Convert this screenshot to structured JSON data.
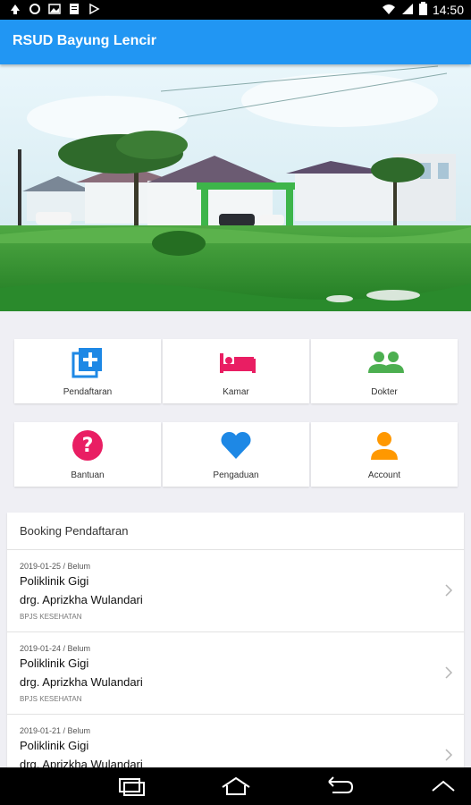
{
  "status_bar": {
    "time": "14:50",
    "left_icons": [
      "notification-icon",
      "sync-icon",
      "image-icon",
      "document-icon",
      "play-icon"
    ],
    "right_icons": [
      "wifi-icon",
      "signal-icon",
      "battery-icon"
    ]
  },
  "app_bar": {
    "title": "RSUD Bayung Lencir"
  },
  "hero": {
    "image": "hospital-building-photo"
  },
  "menu": [
    {
      "label": "Pendaftaran",
      "icon": "add-box-icon",
      "color": "#1e88e5"
    },
    {
      "label": "Kamar",
      "icon": "bed-icon",
      "color": "#e91e63"
    },
    {
      "label": "Dokter",
      "icon": "people-icon",
      "color": "#4caf50"
    },
    {
      "label": "Bantuan",
      "icon": "help-icon",
      "color": "#e91e63"
    },
    {
      "label": "Pengaduan",
      "icon": "heart-icon",
      "color": "#1e88e5"
    },
    {
      "label": "Account",
      "icon": "person-icon",
      "color": "#ff9800"
    }
  ],
  "booking": {
    "title": "Booking Pendaftaran",
    "items": [
      {
        "date_status": "2019-01-25 / Belum",
        "poli": "Poliklinik Gigi",
        "doctor": "drg. Aprizkha Wulandari",
        "insurance": "BPJS KESEHATAN"
      },
      {
        "date_status": "2019-01-24 / Belum",
        "poli": "Poliklinik Gigi",
        "doctor": "drg. Aprizkha Wulandari",
        "insurance": "BPJS KESEHATAN"
      },
      {
        "date_status": "2019-01-21 / Belum",
        "poli": "Poliklinik Gigi",
        "doctor": "drg. Aprizkha Wulandari",
        "insurance": ""
      }
    ]
  },
  "nav_bar": {
    "buttons": [
      "recent-apps-icon",
      "home-icon",
      "back-icon",
      "chevron-up-icon"
    ]
  }
}
